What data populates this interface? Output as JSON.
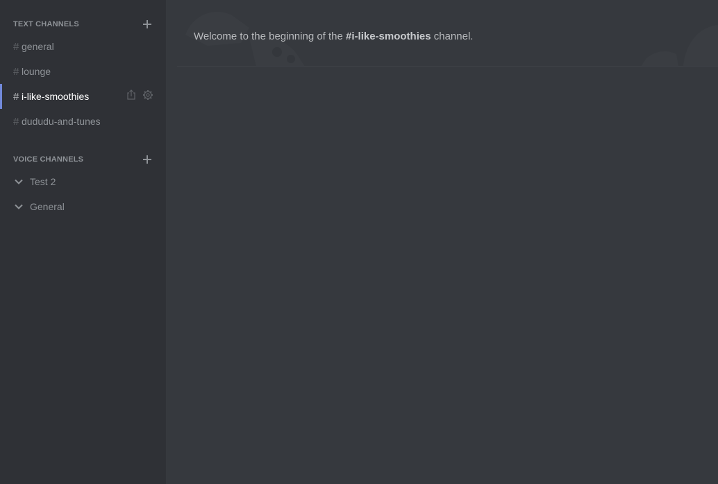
{
  "sidebar": {
    "text_category": {
      "label": "TEXT CHANNELS",
      "add_icon": "plus-icon"
    },
    "text_channels": [
      {
        "hash": "#",
        "name": "general"
      },
      {
        "hash": "#",
        "name": "lounge"
      },
      {
        "hash": "#",
        "name": "i-like-smoothies",
        "active": true
      },
      {
        "hash": "#",
        "name": "dududu-and-tunes"
      }
    ],
    "channel_actions": [
      "share-icon",
      "gear-icon"
    ],
    "voice_category": {
      "label": "VOICE CHANNELS",
      "add_icon": "plus-icon"
    },
    "voice_channels": [
      {
        "name": "Test 2",
        "icon": "chevron-down-icon"
      },
      {
        "name": "General",
        "icon": "chevron-down-icon"
      }
    ]
  },
  "main": {
    "welcome_prefix": "Welcome to the beginning of the ",
    "welcome_channel": "#i-like-smoothies",
    "welcome_suffix": " channel."
  },
  "colors": {
    "sidebar_bg": "#2f3136",
    "main_bg": "#36393e",
    "accent": "#7289da",
    "muted_text": "#8e9297"
  }
}
